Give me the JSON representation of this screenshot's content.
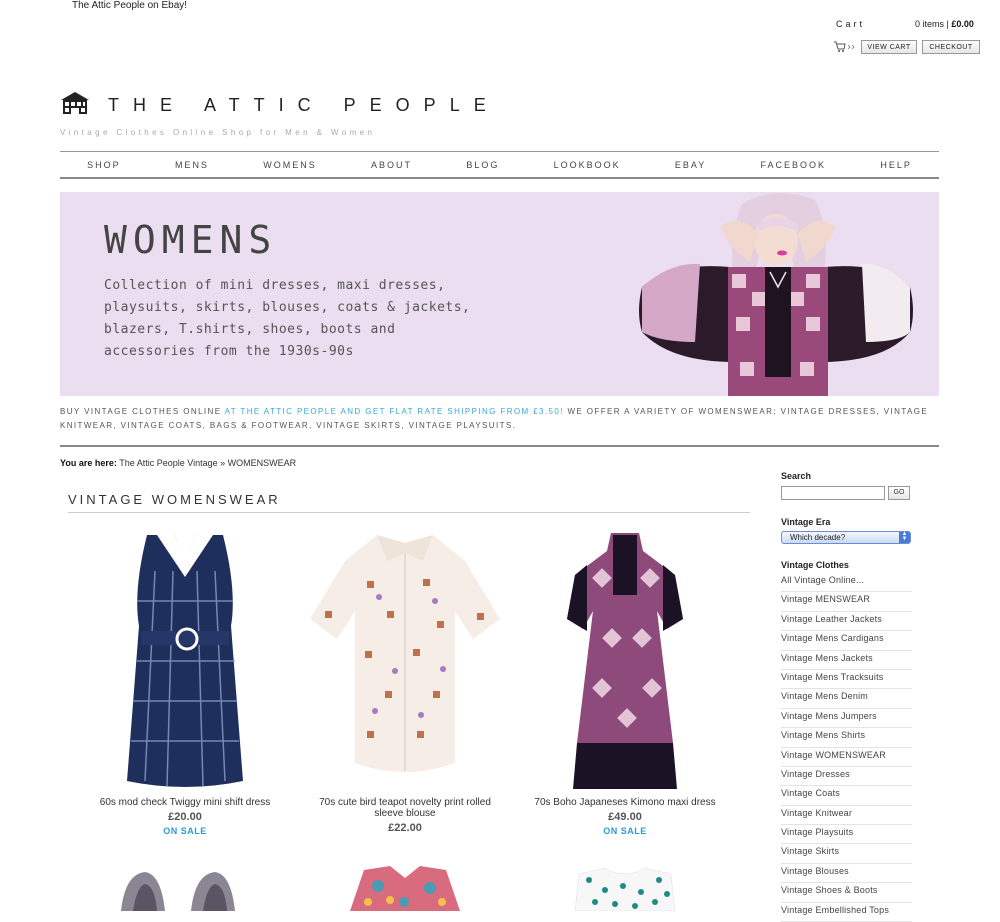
{
  "top": {
    "ebay_link": "The Attic People on Ebay!",
    "cart_label": "Cart",
    "cart_items": "0 items",
    "cart_total": "£0.00",
    "view_cart": "VIEW CART",
    "checkout": "CHECKOUT"
  },
  "logo": {
    "title": "THE ATTIC PEOPLE",
    "tagline": "Vintage Clothes Online Shop for Men & Women"
  },
  "nav": [
    "SHOP",
    "MENS",
    "WOMENS",
    "ABOUT",
    "BLOG",
    "LOOKBOOK",
    "EBAY",
    "FACEBOOK",
    "HELP"
  ],
  "banner": {
    "title": "WOMENS",
    "text": "Collection of mini dresses, maxi dresses, playsuits, skirts, blouses, coats & jackets, blazers, T.shirts, shoes, boots and accessories from the 1930s-90s",
    "bg_color": "#eadef0"
  },
  "intro": {
    "part1": "Buy vintage clothes online ",
    "highlight": "at The Attic People and get flat rate shipping from £3.50!",
    "part2": " We offer a variety of womenswear: vintage dresses, vintage knitwear, vintage coats, bags & footwear, vintage skirts, vintage playsuits."
  },
  "breadcrumb": {
    "prefix": "You are here:",
    "home": "The Attic People Vintage",
    "sep": "»",
    "current": "WOMENSWEAR"
  },
  "section_title": "VINTAGE WOMENSWEAR",
  "products": [
    {
      "name": "60s mod check Twiggy mini shift dress",
      "price": "£20.00",
      "sale": "ON SALE"
    },
    {
      "name": "70s cute bird teapot novelty print rolled sleeve blouse",
      "price": "£22.00",
      "sale": ""
    },
    {
      "name": "70s Boho Japaneses Kimono maxi dress",
      "price": "£49.00",
      "sale": "ON SALE"
    }
  ],
  "sidebar": {
    "search_heading": "Search",
    "go": "GO",
    "era_heading": "Vintage Era",
    "era_select": "Which decade?",
    "clothes_heading": "Vintage Clothes",
    "links": [
      "All Vintage Online...",
      "Vintage MENSWEAR",
      "Vintage Leather Jackets",
      "Vintage Mens Cardigans",
      "Vintage Mens Jackets",
      "Vintage Mens Tracksuits",
      "Vintage Mens Denim",
      "Vintage Mens Jumpers",
      "Vintage Mens Shirts",
      "Vintage WOMENSWEAR",
      "Vintage Dresses",
      "Vintage Coats",
      "Vintage Knitwear",
      "Vintage Playsuits",
      "Vintage Skirts",
      "Vintage Blouses",
      "Vintage Shoes & Boots",
      "Vintage Embellished Tops"
    ]
  },
  "colors": {
    "accent_blue": "#3aa9d6",
    "sale_blue": "#2a9ad8"
  }
}
